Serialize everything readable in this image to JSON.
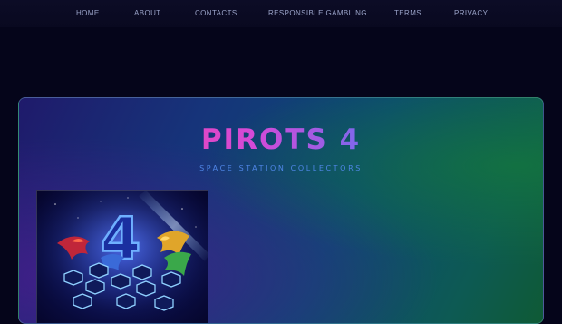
{
  "nav": {
    "items": [
      {
        "label": "HOME"
      },
      {
        "label": "ABOUT"
      },
      {
        "label": "CONTACTS"
      },
      {
        "label": "RESPONSIBLE GAMBLING"
      },
      {
        "label": "TERMS"
      },
      {
        "label": "PRIVACY"
      }
    ]
  },
  "hero": {
    "title": "PIROTS 4",
    "subtitle": "SPACE STATION COLLECTORS",
    "image_number": "4"
  },
  "colors": {
    "background": "#05051a",
    "nav_text": "#9aa3c8",
    "title_start": "#ff3f8e",
    "title_end": "#4a7cff",
    "subtitle": "#4f86e6"
  }
}
